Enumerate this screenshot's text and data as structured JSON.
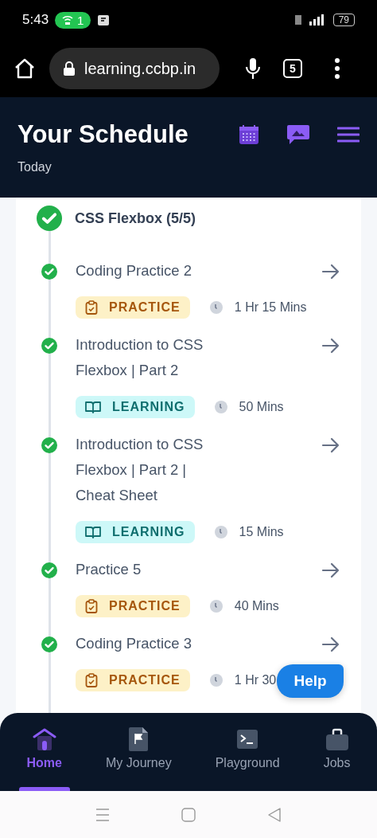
{
  "status_bar": {
    "time": "5:43",
    "hotspot_count": "1",
    "battery": "79"
  },
  "browser": {
    "url": "learning.ccbp.in",
    "tab_count": "5"
  },
  "header": {
    "title": "Your Schedule",
    "subtitle": "Today"
  },
  "module": {
    "title": "CSS Flexbox (5/5)",
    "done": true
  },
  "items": [
    {
      "title": "Coding Practice 2",
      "kind": "practice",
      "tag": "PRACTICE",
      "duration": "1 Hr 15 Mins",
      "done": true
    },
    {
      "title": "Introduction to CSS Flexbox | Part 2",
      "kind": "learning",
      "tag": "LEARNING",
      "duration": "50 Mins",
      "done": true
    },
    {
      "title": "Introduction to CSS Flexbox | Part 2 | Cheat Sheet",
      "kind": "learning",
      "tag": "LEARNING",
      "duration": "15 Mins",
      "done": true
    },
    {
      "title": "Practice 5",
      "kind": "practice",
      "tag": "PRACTICE",
      "duration": "40 Mins",
      "done": true
    },
    {
      "title": "Coding Practice 3",
      "kind": "practice",
      "tag": "PRACTICE",
      "duration": "1 Hr 30",
      "done": true
    }
  ],
  "help_button": "Help",
  "bottom_nav": [
    {
      "label": "Home",
      "kind": "home",
      "selected": true
    },
    {
      "label": "My Journey",
      "kind": "journey",
      "selected": false
    },
    {
      "label": "Playground",
      "kind": "playground",
      "selected": false
    },
    {
      "label": "Jobs",
      "kind": "jobs",
      "selected": false
    }
  ]
}
